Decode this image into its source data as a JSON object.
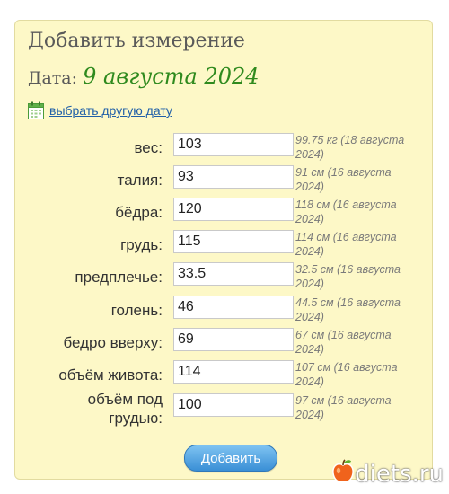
{
  "form": {
    "title": "Добавить измерение",
    "date_label": "Дата: ",
    "date_value": "9 августа 2024",
    "choose_date_link": "выбрать другую дату",
    "submit_label": "Добавить"
  },
  "rows": [
    {
      "label": "вес:",
      "value": "103",
      "previous": "99.75 кг (18 августа 2024)"
    },
    {
      "label": "талия:",
      "value": "93",
      "previous": "91 см (16 августа 2024)"
    },
    {
      "label": "бёдра:",
      "value": "120",
      "previous": "118 см (16 августа 2024)"
    },
    {
      "label": "грудь:",
      "value": "115",
      "previous": "114 см (16 августа 2024)"
    },
    {
      "label": "предплечье:",
      "value": "33.5",
      "previous": "32.5 см (16 августа 2024)"
    },
    {
      "label": "голень:",
      "value": "46",
      "previous": "44.5 см (16 августа 2024)"
    },
    {
      "label": "бедро вверху:",
      "value": "69",
      "previous": "67 см (16 августа 2024)"
    },
    {
      "label": "объём живота:",
      "value": "114",
      "previous": "107 см (16 августа 2024)"
    },
    {
      "label": "объём под грудью:",
      "value": "100",
      "previous": "97 см (16 августа 2024)"
    }
  ],
  "watermark": {
    "text": "diets.ru",
    "icon": "apple-icon"
  },
  "icons": {
    "calendar": "calendar-icon"
  }
}
